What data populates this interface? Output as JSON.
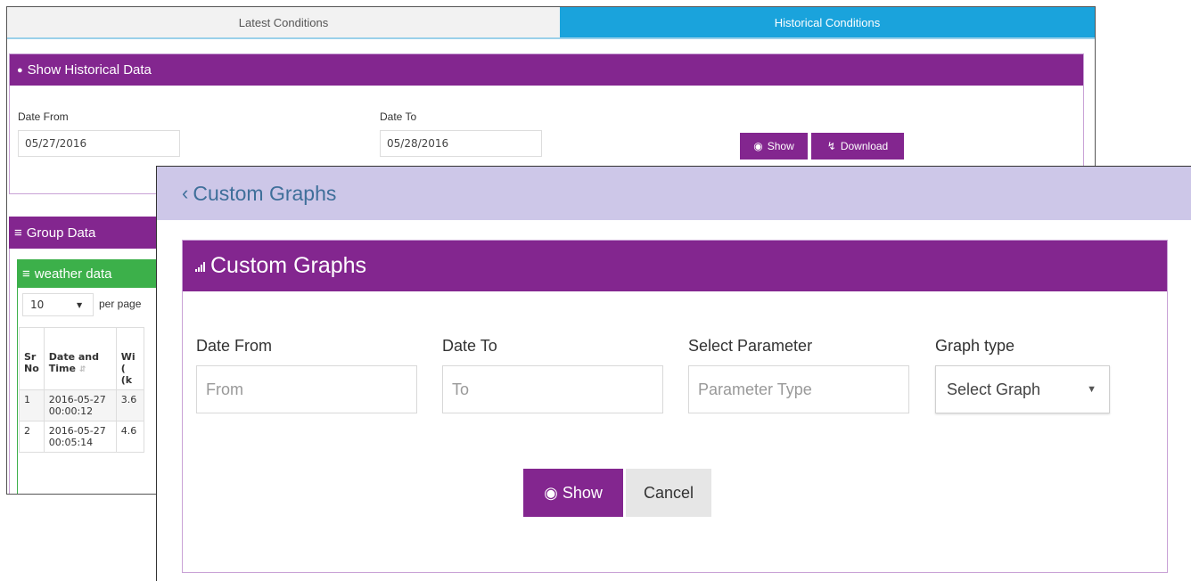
{
  "tabs": {
    "latest": "Latest Conditions",
    "historical": "Historical Conditions"
  },
  "historical_panel": {
    "icon": "globe-icon",
    "title": "Show Historical Data",
    "date_from_label": "Date From",
    "date_from_value": "05/27/2016",
    "date_to_label": "Date To",
    "date_to_value": "05/28/2016",
    "show_label": "Show",
    "download_label": "Download"
  },
  "group_data": {
    "title": "Group Data",
    "weather_title": "weather data",
    "per_page_value": "10",
    "per_page_label": "per page",
    "columns": [
      "Sr No",
      "Date and Time",
      "Wi ( (k"
    ],
    "rows": [
      {
        "sr": "1",
        "datetime": "2016-05-27 00:00:12",
        "val": "3.6"
      },
      {
        "sr": "2",
        "datetime": "2016-05-27 00:05:14",
        "val": "4.6"
      }
    ]
  },
  "custom_graphs": {
    "back_title": "Custom Graphs",
    "panel_title": "Custom Graphs",
    "date_from_label": "Date From",
    "date_from_placeholder": "From",
    "date_to_label": "Date To",
    "date_to_placeholder": "To",
    "parameter_label": "Select Parameter",
    "parameter_placeholder": "Parameter Type",
    "graph_type_label": "Graph type",
    "graph_type_value": "Select Graph",
    "show_label": "Show",
    "cancel_label": "Cancel"
  },
  "colors": {
    "purple": "#83268f",
    "blue_tab": "#1aa3dc",
    "green": "#3cb04a",
    "lavender": "#cdc7e8",
    "link_blue": "#3f6f9a"
  }
}
